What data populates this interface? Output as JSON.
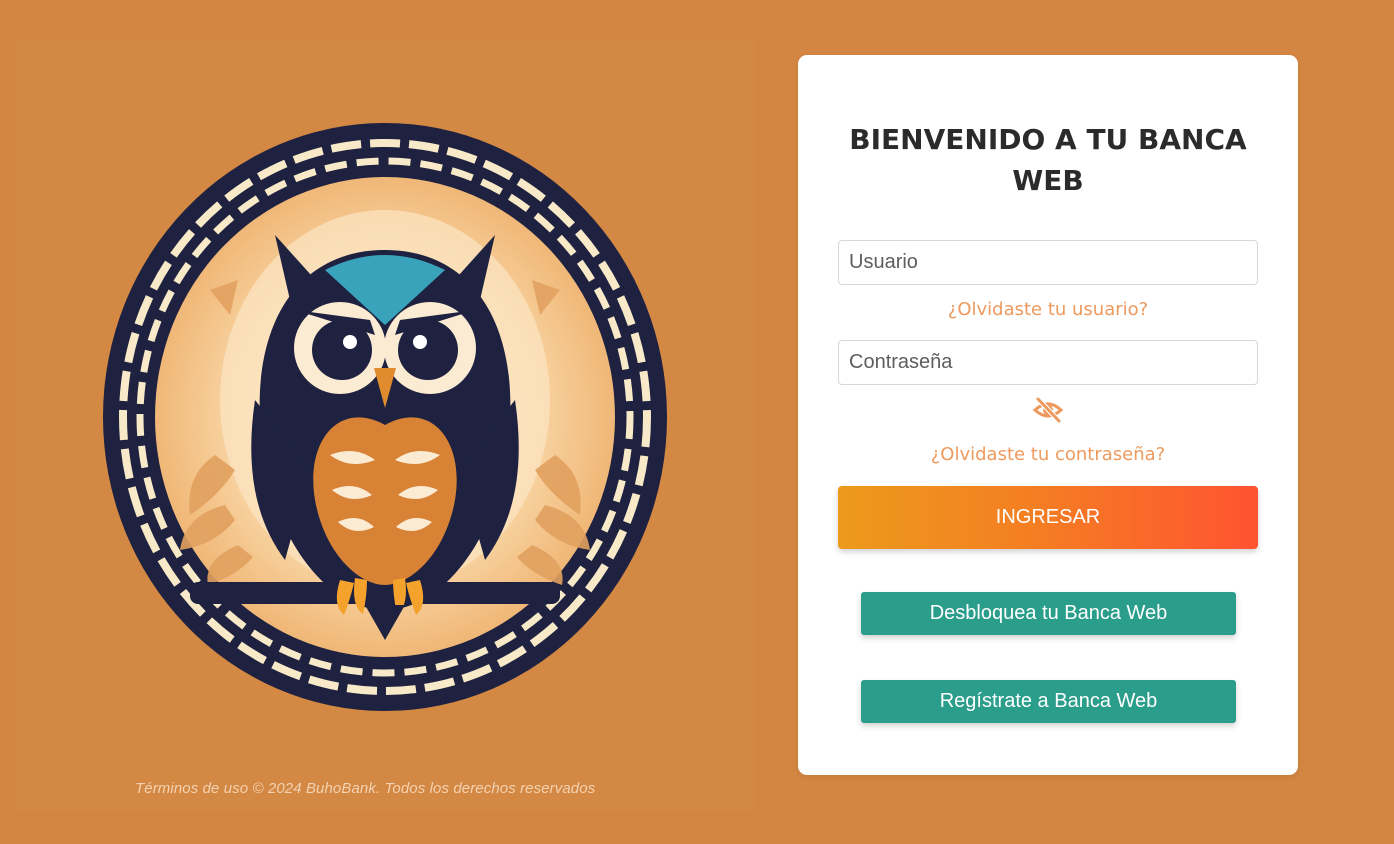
{
  "footer": {
    "text": "Términos de uso © 2024 BuhoBank. Todos los derechos reservados"
  },
  "login": {
    "title": "BIENVENIDO A TU BANCA WEB",
    "username_placeholder": "Usuario",
    "forgot_username": "¿Olvidaste tu usuario?",
    "password_placeholder": "Contraseña",
    "password_toggle_icon": "eye-slash-icon",
    "forgot_password": "¿Olvidaste tu contraseña?",
    "submit_label": "INGRESAR",
    "unlock_label": "Desbloquea tu Banca Web",
    "register_label": "Regístrate a Banca Web"
  },
  "colors": {
    "background": "#D38641",
    "link": "#EE9A5E",
    "primary_gradient_start": "#EC9A1C",
    "primary_gradient_end": "#FF5331",
    "secondary": "#2A9D8B",
    "owl_navy": "#1E2240"
  }
}
